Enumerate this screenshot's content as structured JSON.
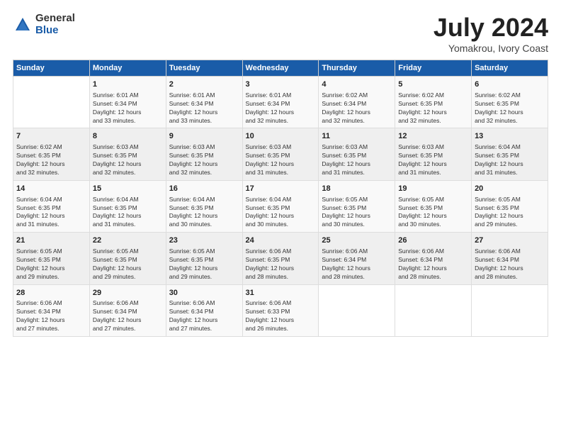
{
  "logo": {
    "general": "General",
    "blue": "Blue"
  },
  "title": "July 2024",
  "subtitle": "Yomakrou, Ivory Coast",
  "weekdays": [
    "Sunday",
    "Monday",
    "Tuesday",
    "Wednesday",
    "Thursday",
    "Friday",
    "Saturday"
  ],
  "weeks": [
    [
      {
        "day": "",
        "info": ""
      },
      {
        "day": "1",
        "info": "Sunrise: 6:01 AM\nSunset: 6:34 PM\nDaylight: 12 hours\nand 33 minutes."
      },
      {
        "day": "2",
        "info": "Sunrise: 6:01 AM\nSunset: 6:34 PM\nDaylight: 12 hours\nand 33 minutes."
      },
      {
        "day": "3",
        "info": "Sunrise: 6:01 AM\nSunset: 6:34 PM\nDaylight: 12 hours\nand 32 minutes."
      },
      {
        "day": "4",
        "info": "Sunrise: 6:02 AM\nSunset: 6:34 PM\nDaylight: 12 hours\nand 32 minutes."
      },
      {
        "day": "5",
        "info": "Sunrise: 6:02 AM\nSunset: 6:35 PM\nDaylight: 12 hours\nand 32 minutes."
      },
      {
        "day": "6",
        "info": "Sunrise: 6:02 AM\nSunset: 6:35 PM\nDaylight: 12 hours\nand 32 minutes."
      }
    ],
    [
      {
        "day": "7",
        "info": "Sunrise: 6:02 AM\nSunset: 6:35 PM\nDaylight: 12 hours\nand 32 minutes."
      },
      {
        "day": "8",
        "info": "Sunrise: 6:03 AM\nSunset: 6:35 PM\nDaylight: 12 hours\nand 32 minutes."
      },
      {
        "day": "9",
        "info": "Sunrise: 6:03 AM\nSunset: 6:35 PM\nDaylight: 12 hours\nand 32 minutes."
      },
      {
        "day": "10",
        "info": "Sunrise: 6:03 AM\nSunset: 6:35 PM\nDaylight: 12 hours\nand 31 minutes."
      },
      {
        "day": "11",
        "info": "Sunrise: 6:03 AM\nSunset: 6:35 PM\nDaylight: 12 hours\nand 31 minutes."
      },
      {
        "day": "12",
        "info": "Sunrise: 6:03 AM\nSunset: 6:35 PM\nDaylight: 12 hours\nand 31 minutes."
      },
      {
        "day": "13",
        "info": "Sunrise: 6:04 AM\nSunset: 6:35 PM\nDaylight: 12 hours\nand 31 minutes."
      }
    ],
    [
      {
        "day": "14",
        "info": "Sunrise: 6:04 AM\nSunset: 6:35 PM\nDaylight: 12 hours\nand 31 minutes."
      },
      {
        "day": "15",
        "info": "Sunrise: 6:04 AM\nSunset: 6:35 PM\nDaylight: 12 hours\nand 31 minutes."
      },
      {
        "day": "16",
        "info": "Sunrise: 6:04 AM\nSunset: 6:35 PM\nDaylight: 12 hours\nand 30 minutes."
      },
      {
        "day": "17",
        "info": "Sunrise: 6:04 AM\nSunset: 6:35 PM\nDaylight: 12 hours\nand 30 minutes."
      },
      {
        "day": "18",
        "info": "Sunrise: 6:05 AM\nSunset: 6:35 PM\nDaylight: 12 hours\nand 30 minutes."
      },
      {
        "day": "19",
        "info": "Sunrise: 6:05 AM\nSunset: 6:35 PM\nDaylight: 12 hours\nand 30 minutes."
      },
      {
        "day": "20",
        "info": "Sunrise: 6:05 AM\nSunset: 6:35 PM\nDaylight: 12 hours\nand 29 minutes."
      }
    ],
    [
      {
        "day": "21",
        "info": "Sunrise: 6:05 AM\nSunset: 6:35 PM\nDaylight: 12 hours\nand 29 minutes."
      },
      {
        "day": "22",
        "info": "Sunrise: 6:05 AM\nSunset: 6:35 PM\nDaylight: 12 hours\nand 29 minutes."
      },
      {
        "day": "23",
        "info": "Sunrise: 6:05 AM\nSunset: 6:35 PM\nDaylight: 12 hours\nand 29 minutes."
      },
      {
        "day": "24",
        "info": "Sunrise: 6:06 AM\nSunset: 6:35 PM\nDaylight: 12 hours\nand 28 minutes."
      },
      {
        "day": "25",
        "info": "Sunrise: 6:06 AM\nSunset: 6:34 PM\nDaylight: 12 hours\nand 28 minutes."
      },
      {
        "day": "26",
        "info": "Sunrise: 6:06 AM\nSunset: 6:34 PM\nDaylight: 12 hours\nand 28 minutes."
      },
      {
        "day": "27",
        "info": "Sunrise: 6:06 AM\nSunset: 6:34 PM\nDaylight: 12 hours\nand 28 minutes."
      }
    ],
    [
      {
        "day": "28",
        "info": "Sunrise: 6:06 AM\nSunset: 6:34 PM\nDaylight: 12 hours\nand 27 minutes."
      },
      {
        "day": "29",
        "info": "Sunrise: 6:06 AM\nSunset: 6:34 PM\nDaylight: 12 hours\nand 27 minutes."
      },
      {
        "day": "30",
        "info": "Sunrise: 6:06 AM\nSunset: 6:34 PM\nDaylight: 12 hours\nand 27 minutes."
      },
      {
        "day": "31",
        "info": "Sunrise: 6:06 AM\nSunset: 6:33 PM\nDaylight: 12 hours\nand 26 minutes."
      },
      {
        "day": "",
        "info": ""
      },
      {
        "day": "",
        "info": ""
      },
      {
        "day": "",
        "info": ""
      }
    ]
  ]
}
